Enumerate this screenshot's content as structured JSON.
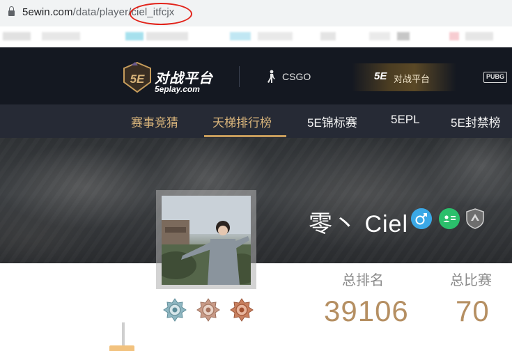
{
  "browser": {
    "url_host": "5ewin.com",
    "url_path": "/data/player/ciel_itfcjx"
  },
  "header": {
    "logo_title": "对战平台",
    "logo_subtitle": "5eplay.com",
    "logo_badge_text": "5E",
    "games": [
      {
        "label": "CSGO",
        "icon": "csgo-soldier-icon"
      },
      {
        "label": "对战平台",
        "icon": "5e-mini-logo-icon",
        "badge_text": "5E",
        "active": true
      },
      {
        "label": "PUBG",
        "icon": "pubg-icon"
      }
    ]
  },
  "nav": {
    "items": [
      {
        "label": "赛事竞猜"
      },
      {
        "label": "天梯排行榜",
        "active": true
      },
      {
        "label": "5E锦标赛"
      },
      {
        "label": "5EPL"
      },
      {
        "label": "5E封禁榜"
      }
    ]
  },
  "profile": {
    "name": "零丶 Ciel",
    "badges": [
      "male-gender-icon",
      "id-verified-icon",
      "shield-rank-icon"
    ]
  },
  "stats": [
    {
      "label": "总排名",
      "value": "39106"
    },
    {
      "label": "总比赛",
      "value": "70"
    }
  ],
  "medals": [
    "silver-medal-icon",
    "bronze-medal-icon",
    "copper-medal-icon"
  ],
  "colors": {
    "header_bg": "#141821",
    "nav_bg": "#262a35",
    "accent_gold": "#c79d5c",
    "stat_value": "#b58f62",
    "annotation_red": "#e2231a"
  }
}
